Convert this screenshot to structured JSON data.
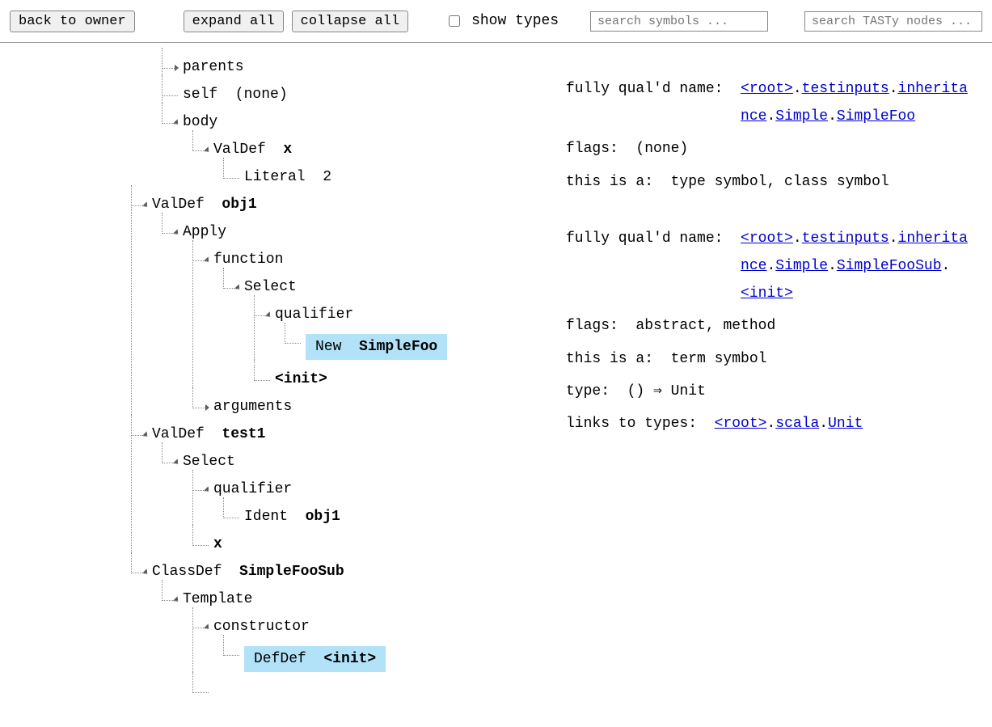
{
  "toolbar": {
    "back": "back to owner",
    "expand": "expand all",
    "collapse": "collapse all",
    "show_types": "show types",
    "search_symbols_ph": "search symbols ...",
    "search_tasty_ph": "search TASTy nodes ..."
  },
  "tree": {
    "constructor_cut": "ructor",
    "parents": "parents",
    "self": "self  (none)",
    "body": "body",
    "valdef_x": "ValDef  ",
    "valdef_x_name": "x",
    "literal": "Literal  ",
    "literal_val": "2",
    "valdef_obj1": "ValDef  ",
    "valdef_obj1_name": "obj1",
    "apply": "Apply",
    "function": "function",
    "select": "Select",
    "qualifier": "qualifier",
    "new": "New  ",
    "new_name": "SimpleFoo",
    "init": "<init>",
    "arguments": "arguments",
    "valdef_test1": "ValDef  ",
    "valdef_test1_name": "test1",
    "select2": "Select",
    "qualifier2": "qualifier",
    "ident": "Ident  ",
    "ident_name": "obj1",
    "x": "x",
    "classdef": "ClassDef  ",
    "classdef_name": "SimpleFooSub",
    "template": "Template",
    "constructor": "constructor",
    "defdef": "DefDef  ",
    "defdef_name": "<init>"
  },
  "info": {
    "fqn_label": "fully qual'd name:  ",
    "fqn1_parts": [
      "<root>",
      ".",
      "testinputs",
      ".",
      "inheritance",
      ".",
      "Simple",
      ".",
      "SimpleFoo"
    ],
    "flags_label": "flags:  ",
    "flags1": "(none)",
    "thisis_label": "this is a:  ",
    "thisis1": "type symbol, class symbol",
    "fqn2_parts": [
      "<root>",
      ".",
      "testinputs",
      ".",
      "inheritance",
      ".",
      "Simple",
      ".",
      "SimpleFooSub",
      ".",
      "<init>"
    ],
    "flags2": "abstract, method",
    "thisis2": "term symbol",
    "type_label": "type:  ",
    "type_val": "() ⇒ Unit",
    "links_label": "links to types:  ",
    "links_parts": [
      "<root>",
      ".",
      "scala",
      ".",
      "Unit"
    ]
  }
}
